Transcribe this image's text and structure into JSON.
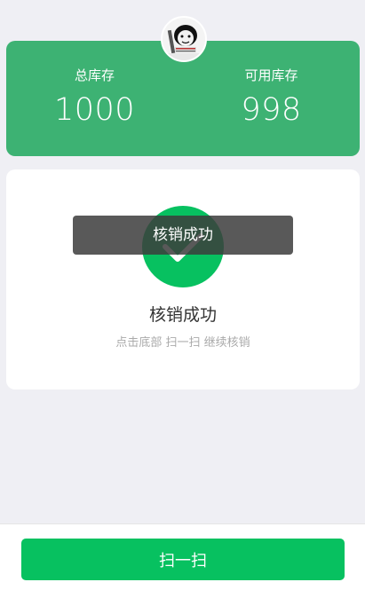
{
  "stock": {
    "total_label": "总库存",
    "total_value": "1000",
    "available_label": "可用库存",
    "available_value": "998"
  },
  "avatar": {
    "icon": "meme-avatar"
  },
  "result": {
    "icon": "checkmark-icon",
    "title": "核销成功",
    "hint": "点击底部 扫一扫 继续核销"
  },
  "toast": {
    "message": "核销成功"
  },
  "bottom": {
    "scan_label": "扫一扫"
  },
  "colors": {
    "stock_card": "#3db273",
    "primary_green": "#07c160",
    "background": "#efeff4"
  }
}
